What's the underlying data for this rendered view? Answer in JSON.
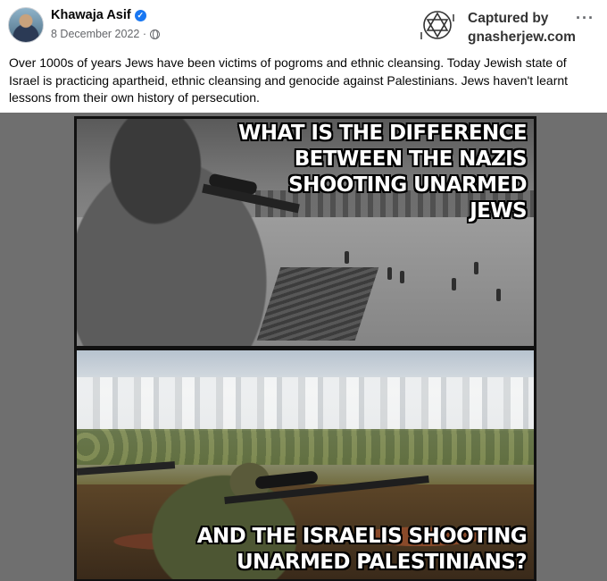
{
  "post": {
    "author": "Khawaja Asif",
    "verified_icon": "verified-badge-icon",
    "date": "8 December 2022 ·",
    "audience_icon": "globe-icon",
    "more_label": "···",
    "text": "Over 1000s of years Jews have been victims of pogroms and ethnic cleansing. Today Jewish state of Israel is practicing apartheid, ethnic cleansing and genocide against Palestinians. Jews haven't  learnt lessons from their own history of persecution."
  },
  "watermark": {
    "line1": "Captured by",
    "line2": "gnasherjew.com",
    "logo_icon": "star-of-david-logo-icon"
  },
  "image": {
    "caption_top_lines": [
      "WHAT IS THE DIFFERENCE",
      "BETWEEN THE NAZIS",
      "SHOOTING UNARMED JEWS"
    ],
    "caption_bottom_lines": [
      "AND THE ISRAELIS SHOOTING",
      "UNARMED PALESTINIANS?"
    ]
  },
  "colors": {
    "accent": "#1877f2",
    "secondary_text": "#65676b",
    "media_background": "#6f6f6f"
  }
}
